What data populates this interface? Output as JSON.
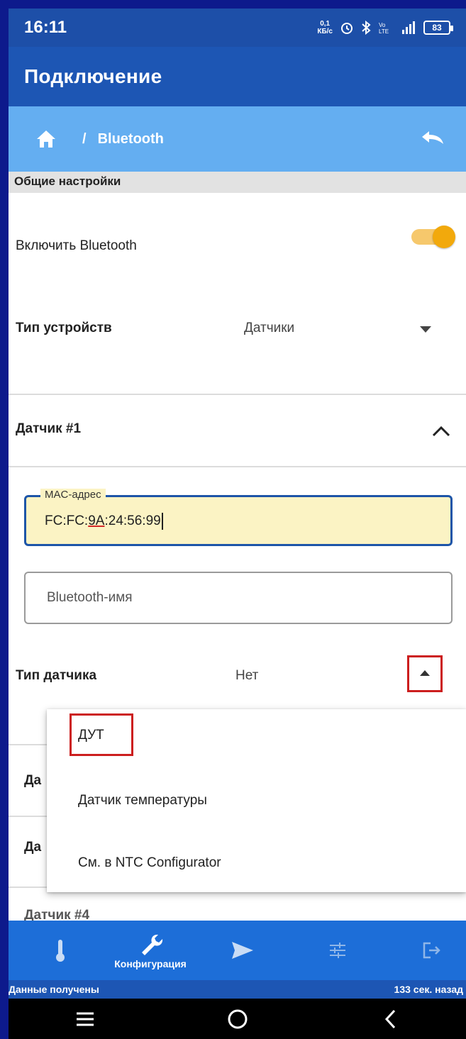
{
  "status_bar": {
    "time": "16:11",
    "net_speed_top": "0,1",
    "net_speed_bottom": "КБ/с",
    "battery": "83"
  },
  "app_bar": {
    "title": "Подключение"
  },
  "breadcrumb": {
    "separator": "/",
    "current": "Bluetooth"
  },
  "section": {
    "title": "Общие настройки"
  },
  "bluetooth_toggle": {
    "label": "Включить Bluetooth",
    "on": true
  },
  "device_type": {
    "label": "Тип устройств",
    "value": "Датчики"
  },
  "sensor1": {
    "title": "Датчик #1"
  },
  "mac_field": {
    "legend": "MAC-адрес",
    "value_prefix": "FC:FC:",
    "value_error": "9A",
    "value_suffix": ":24:56:99"
  },
  "bt_name_field": {
    "placeholder": "Bluetooth-имя"
  },
  "sensor_type": {
    "label": "Тип датчика",
    "value": "Нет"
  },
  "hidden_rows": {
    "row1": "Да",
    "row2": "Да",
    "row3": "Датчик #4"
  },
  "dropdown": {
    "options": [
      "ДУТ",
      "Датчик температуры",
      "См. в NTC Configurator"
    ],
    "highlighted": "ДУТ"
  },
  "bottom_nav": {
    "items": [
      {
        "icon": "thermometer-icon",
        "label": ""
      },
      {
        "icon": "wrench-icon",
        "label": "Конфигурация",
        "active": true
      },
      {
        "icon": "send-icon",
        "label": ""
      },
      {
        "icon": "sliders-icon",
        "label": ""
      },
      {
        "icon": "logout-icon",
        "label": ""
      }
    ]
  },
  "status_strip": {
    "left": "Данные получены",
    "right": "133 сек. назад"
  },
  "colors": {
    "app_bar": "#1d56b4",
    "breadcrumb": "#64aef1",
    "toggle_on": "#f2a90c",
    "highlight_box": "#cc1e1e",
    "mac_bg": "#fbf3c4"
  }
}
